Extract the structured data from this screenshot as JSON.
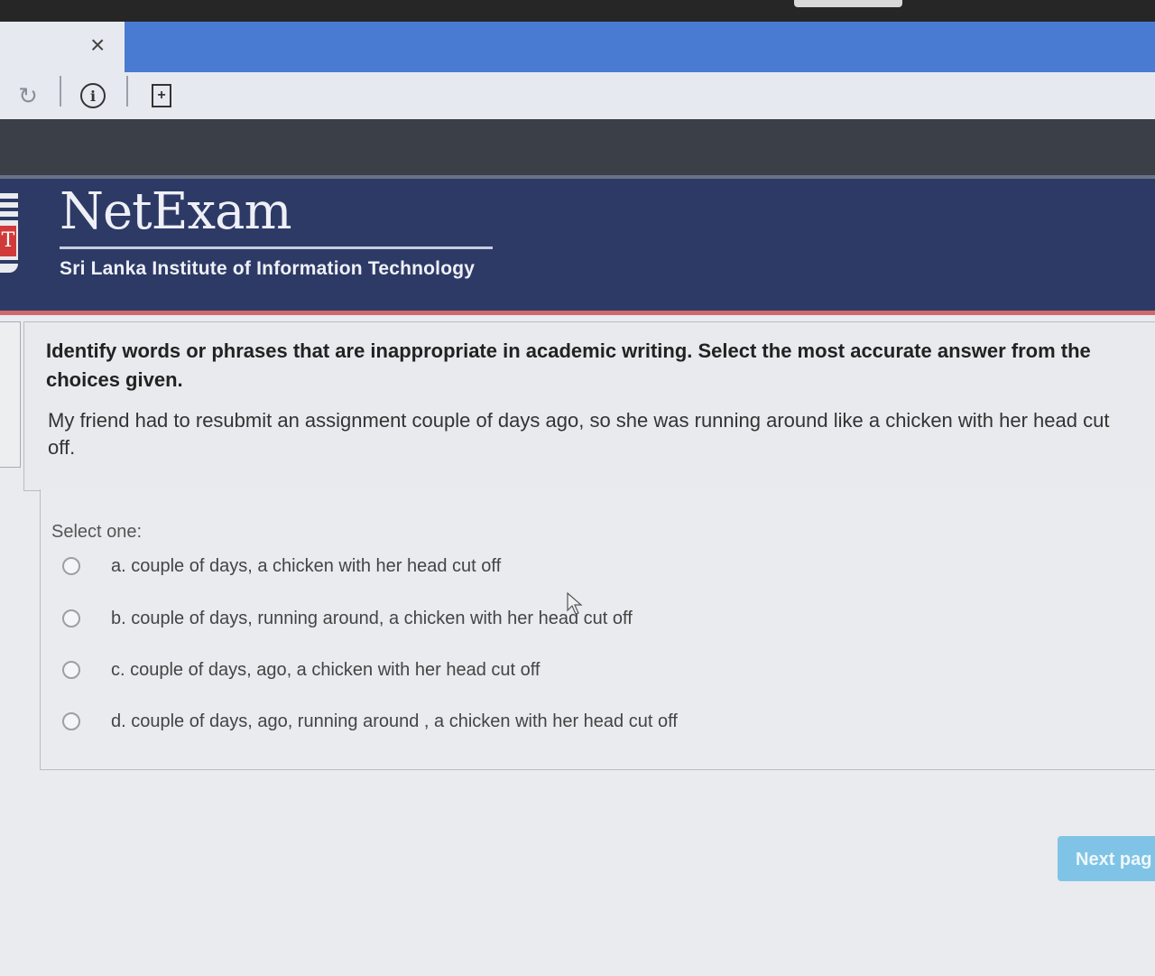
{
  "browser": {
    "tab_close_glyph": "×",
    "icons": [
      "reload-icon",
      "info-icon",
      "bookmark-icon"
    ]
  },
  "header": {
    "title": "NetExam",
    "subtitle": "Sri Lanka Institute of Information Technology",
    "crest_letter": "T"
  },
  "question": {
    "prompt": "Identify words or phrases that are inappropriate in academic writing. Select the most accurate answer from the choices given.",
    "sentence": "My friend had to resubmit an assignment couple of days ago, so she was running around like a chicken with her head cut off."
  },
  "answers": {
    "label": "Select one:",
    "options": [
      "a. couple of days, a chicken with her head cut off",
      "b. couple of days, running around, a chicken with her head cut off",
      "c. couple of days, ago, a chicken with her head cut off",
      "d. couple of days, ago, running around , a chicken with her head cut off"
    ]
  },
  "navigation": {
    "next_label": "Next pag"
  },
  "colors": {
    "header_bg": "#2e3a66",
    "accent_red": "#d06a6a",
    "next_button": "#7fc4e6",
    "tabstrip": "#4a7bd2"
  }
}
